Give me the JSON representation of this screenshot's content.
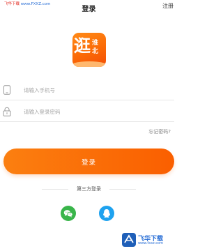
{
  "watermark_top": {
    "prefix": "飞华下载",
    "url": "www.FXXZ.com"
  },
  "header": {
    "title": "登录",
    "register": "注册"
  },
  "logo": {
    "char_main": "逛",
    "char_top": "淮",
    "char_bottom": "北"
  },
  "form": {
    "phone_placeholder": "请输入手机号",
    "password_placeholder": "请输入登录密码",
    "forgot": "忘记密码?"
  },
  "login_button": "登录",
  "third_party": {
    "label": "第三方登录",
    "providers": [
      "wechat",
      "qq"
    ]
  },
  "watermark_bottom": {
    "text": "飞华下载",
    "url": "www.fxxz.com"
  },
  "colors": {
    "accent": "#fa6a0a",
    "wechat": "#39b54a",
    "qq": "#1ea2ef"
  }
}
